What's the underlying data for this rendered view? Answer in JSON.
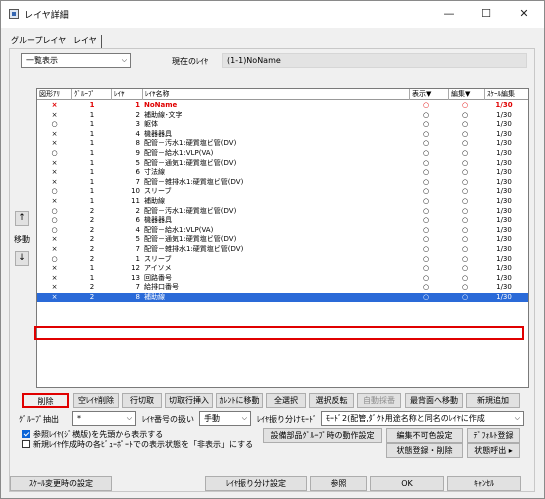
{
  "window": {
    "title": "レイヤ詳細",
    "min": "—",
    "max": "☐",
    "close": "✕"
  },
  "tabs": [
    "グループレイヤ",
    "レイヤ"
  ],
  "view_combo": "一覧表示",
  "current_layer_label": "現在のﾚｲﾔ",
  "current_layer_value": "(1-1)NoName",
  "table": {
    "headers": [
      "図形ｱﾘ",
      "ｸﾞﾙｰﾌﾟ",
      "ﾚｲﾔ",
      "ﾚｲﾔ名称",
      "表示▼",
      "編集▼",
      "ｽｹｰﾙ編集"
    ],
    "rows": [
      {
        "type": "×",
        "group": "1",
        "layer": "1",
        "name": "NoName",
        "disp": "○",
        "edit": "○",
        "scale": "1/30",
        "style": "red"
      },
      {
        "type": "×",
        "group": "1",
        "layer": "2",
        "name": "補助線･文字",
        "disp": "○",
        "edit": "○",
        "scale": "1/30"
      },
      {
        "type": "○",
        "group": "1",
        "layer": "3",
        "name": "躯体",
        "disp": "○",
        "edit": "○",
        "scale": "1/30"
      },
      {
        "type": "×",
        "group": "1",
        "layer": "4",
        "name": "機器器具",
        "disp": "○",
        "edit": "○",
        "scale": "1/30"
      },
      {
        "type": "×",
        "group": "1",
        "layer": "8",
        "name": "配管－汚水1:硬質塩ビ管(DV)",
        "disp": "○",
        "edit": "○",
        "scale": "1/30"
      },
      {
        "type": "○",
        "group": "1",
        "layer": "9",
        "name": "配管－給水1:VLP(VA)",
        "disp": "○",
        "edit": "○",
        "scale": "1/30"
      },
      {
        "type": "×",
        "group": "1",
        "layer": "5",
        "name": "配管－通気1:硬質塩ビ管(DV)",
        "disp": "○",
        "edit": "○",
        "scale": "1/30"
      },
      {
        "type": "×",
        "group": "1",
        "layer": "6",
        "name": "寸法線",
        "disp": "○",
        "edit": "○",
        "scale": "1/30"
      },
      {
        "type": "×",
        "group": "1",
        "layer": "7",
        "name": "配管－雑排水1:硬質塩ビ管(DV)",
        "disp": "○",
        "edit": "○",
        "scale": "1/30"
      },
      {
        "type": "○",
        "group": "1",
        "layer": "10",
        "name": "スリーブ",
        "disp": "○",
        "edit": "○",
        "scale": "1/30"
      },
      {
        "type": "×",
        "group": "1",
        "layer": "11",
        "name": "補助線",
        "disp": "○",
        "edit": "○",
        "scale": "1/30"
      },
      {
        "type": "○",
        "group": "2",
        "layer": "2",
        "name": "配管－汚水1:硬質塩ビ管(DV)",
        "disp": "○",
        "edit": "○",
        "scale": "1/30"
      },
      {
        "type": "○",
        "group": "2",
        "layer": "6",
        "name": "機器器具",
        "disp": "○",
        "edit": "○",
        "scale": "1/30"
      },
      {
        "type": "○",
        "group": "2",
        "layer": "4",
        "name": "配管－給水1:VLP(VA)",
        "disp": "○",
        "edit": "○",
        "scale": "1/30"
      },
      {
        "type": "×",
        "group": "2",
        "layer": "5",
        "name": "配管－通気1:硬質塩ビ管(DV)",
        "disp": "○",
        "edit": "○",
        "scale": "1/30"
      },
      {
        "type": "×",
        "group": "2",
        "layer": "7",
        "name": "配管－雑排水1:硬質塩ビ管(DV)",
        "disp": "○",
        "edit": "○",
        "scale": "1/30"
      },
      {
        "type": "○",
        "group": "2",
        "layer": "1",
        "name": "スリーブ",
        "disp": "○",
        "edit": "○",
        "scale": "1/30"
      },
      {
        "type": "×",
        "group": "1",
        "layer": "12",
        "name": "アイソメ",
        "disp": "○",
        "edit": "○",
        "scale": "1/30"
      },
      {
        "type": "×",
        "group": "1",
        "layer": "13",
        "name": "回路番号",
        "disp": "○",
        "edit": "○",
        "scale": "1/30"
      },
      {
        "type": "×",
        "group": "2",
        "layer": "7",
        "name": "給排口番号",
        "disp": "○",
        "edit": "○",
        "scale": "1/30"
      },
      {
        "type": "×",
        "group": "2",
        "layer": "8",
        "name": "補助線",
        "disp": "○",
        "edit": "○",
        "scale": "1/30",
        "style": "sel"
      }
    ]
  },
  "move": {
    "up": "↑",
    "label": "移動",
    "down": "↓"
  },
  "buttons_row1": [
    "削除",
    "空ﾚｲﾔ削除",
    "行切取",
    "切取行挿入",
    "ｶﾚﾝﾄに移動",
    "全選択",
    "選択反転",
    "自動採番",
    "最背面へ移動",
    "新規追加"
  ],
  "group_extract_label": "ｸﾞﾙｰﾌﾟ抽出",
  "group_extract_value": "*",
  "layer_num_label": "ﾚｲﾔ番号の扱い",
  "layer_num_value": "手動",
  "layer_split_label": "ﾚｲﾔ振り分けﾓｰﾄﾞ",
  "layer_split_value": "ﾓｰﾄﾞ2(配管,ﾀﾞｸﾄ用途名称と同名のﾚｲﾔに作成",
  "chk1": "参照ﾚｲﾔ(ｼﾞ横版)を先頭から表示する",
  "chk2": "新規ﾚｲﾔ作成時の各ﾋﾞｭｰﾎﾟｰﾄでの表示状態を「非表示」にする",
  "btn_equipment": "設備部品ｸﾞﾙｰﾌﾟ時の動作設定",
  "btn_no_edit": "編集不可色設定",
  "btn_default": "ﾃﾞﾌｫﾙﾄ登録",
  "btn_state_del": "状態登録・削除",
  "btn_state_out": "状態呼出 ▸",
  "bottom": [
    "ｽｹｰﾙ変更時の設定",
    "ﾚｲﾔ振り分け設定",
    "参照",
    "OK",
    "ｷｬﾝｾﾙ"
  ]
}
